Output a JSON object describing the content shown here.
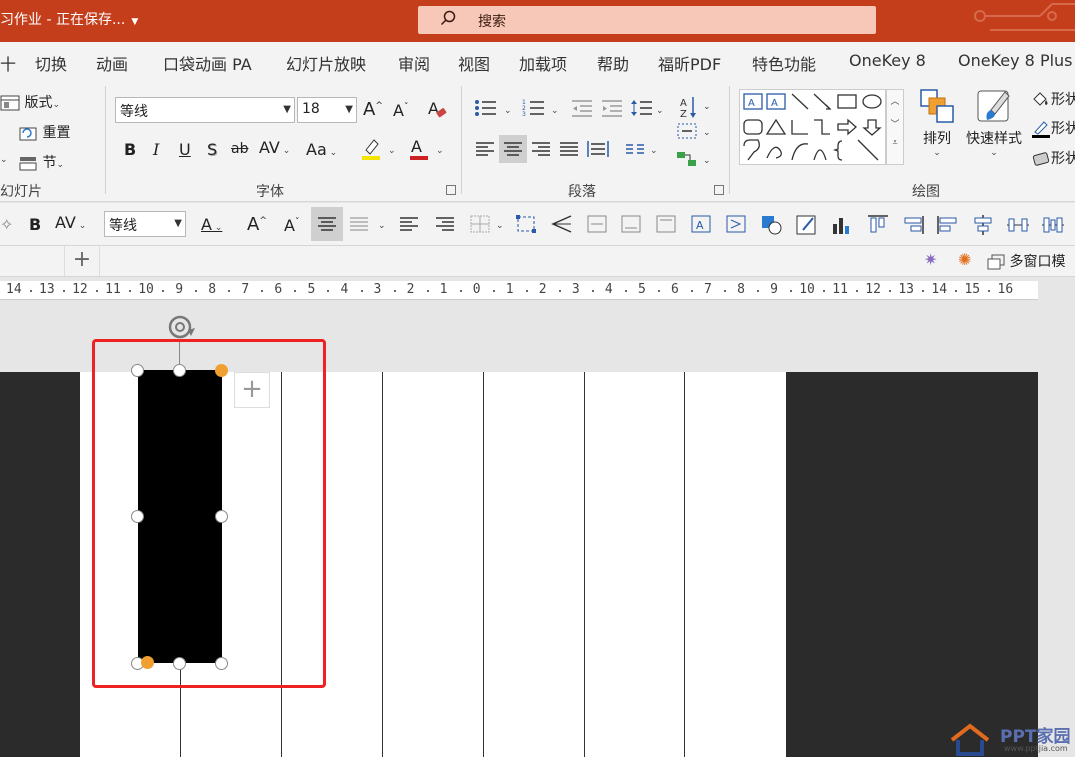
{
  "titlebar": {
    "doc_title": "习作业 - 正在保存...",
    "search_label": "搜索",
    "color": "#c43e1c"
  },
  "tabs": [
    "十",
    "切换",
    "动画",
    "口袋动画 PA",
    "幻灯片放映",
    "审阅",
    "视图",
    "加载项",
    "帮助",
    "福昕PDF",
    "特色功能",
    "OneKey 8",
    "OneKey 8 Plus"
  ],
  "ribbon": {
    "slides": {
      "layout": "版式",
      "reset": "重置",
      "section": "节",
      "group_label": "幻灯片"
    },
    "font": {
      "name": "等线",
      "size": "18",
      "group_label": "字体"
    },
    "paragraph": {
      "group_label": "段落"
    },
    "drawing": {
      "arrange": "排列",
      "quick_styles": "快速样式",
      "shape_fill": "形状",
      "shape_outline": "形状",
      "shape_effects": "形状",
      "group_label": "绘图"
    }
  },
  "mini_toolbar": {
    "font_name": "等线"
  },
  "strip": {
    "multi_window": "多窗口模"
  },
  "ruler": {
    "labels": [
      "14",
      "13",
      "12",
      "11",
      "10",
      "9",
      "8",
      "7",
      "6",
      "5",
      "4",
      "3",
      "2",
      "1",
      "0",
      "1",
      "2",
      "3",
      "4",
      "5",
      "6",
      "7",
      "8",
      "9",
      "10",
      "11",
      "12",
      "13",
      "14",
      "15",
      "16"
    ]
  },
  "watermark": {
    "brand": "PPT家园",
    "url": "www.pptjia.com"
  }
}
